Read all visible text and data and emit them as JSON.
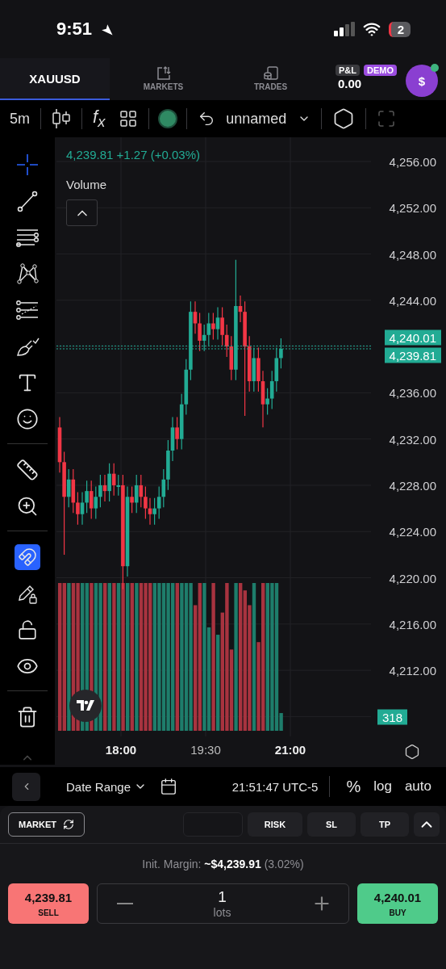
{
  "status_bar": {
    "time": "9:51",
    "battery": "2"
  },
  "header": {
    "tabs": [
      {
        "label": "XAUUSD",
        "selected": true
      },
      {
        "label": "MARKETS",
        "selected": false
      },
      {
        "label": "TRADES",
        "selected": false
      }
    ],
    "pnl": {
      "label": "P&L",
      "value": "0.00"
    },
    "mode_badge": "DEMO",
    "avatar": {
      "glyph": "$",
      "online": true
    }
  },
  "toolbar": {
    "interval": "5m",
    "indicators": "f$_{x}$",
    "layout_name": "unnamed",
    "live": true
  },
  "drawing_tools": [
    [
      {
        "selected": true
      },
      {
        "selected": false
      },
      {
        "selected": false
      },
      {
        "selected": false
      },
      {
        "selected": false
      },
      {
        "selected": false
      },
      {
        "selected": false
      },
      {
        "selected": false
      }
    ],
    [
      {
        "selected": false
      },
      {
        "selected": false
      }
    ],
    [
      {
        "selected": false,
        "on": true
      },
      {
        "selected": false
      },
      {
        "selected": false
      },
      {
        "selected": false
      }
    ],
    [
      {
        "selected": false
      }
    ]
  ],
  "chart": {
    "quote": "4,239.81 +1.27 (+0.03%)",
    "legend": "Volume",
    "legend_expanded": false,
    "price_ticks": [
      "4,256.00",
      "4,252.00",
      "4,248.00",
      "4,244.00",
      "4,236.00",
      "4,232.00",
      "4,228.00",
      "4,224.00",
      "4,220.00",
      "4,216.00",
      "4,212.00"
    ],
    "ask_label": "4,240.01",
    "bid_label": "4,239.81",
    "volume_label": "318",
    "time_labels": [
      {
        "label": "18:00",
        "major": true
      },
      {
        "label": "19:30",
        "major": false
      },
      {
        "label": "21:00",
        "major": true
      }
    ]
  },
  "range_bar": {
    "date_range": "Date Range",
    "clock": "21:51:47 UTC-5",
    "percent": "%",
    "log": "log",
    "auto": "auto"
  },
  "order_panel": {
    "order_type": "MARKET",
    "options": [
      "RISK",
      "SL",
      "TP"
    ],
    "margin": "Init. Margin: **~$4,239.91** (3.02%)",
    "sell": {
      "price": "4,239.81",
      "label": "SELL"
    },
    "quantity": {
      "value": "1",
      "unit": "lots"
    },
    "buy": {
      "price": "4,240.01",
      "label": "BUY"
    }
  }
}
